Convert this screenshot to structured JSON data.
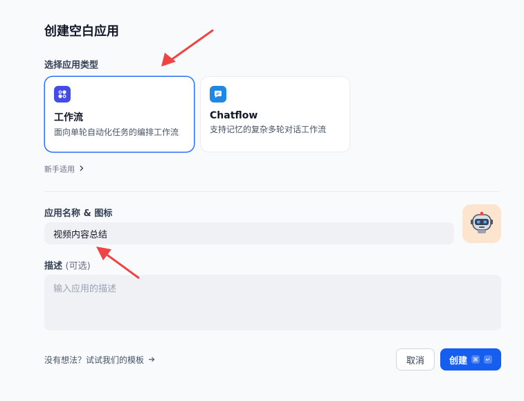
{
  "dialog": {
    "title": "创建空白应用",
    "type_label": "选择应用类型",
    "beginner_link": "新手适用",
    "name_icon_label": "应用名称 & 图标",
    "name_value": "视频内容总结",
    "description_label": "描述",
    "description_optional": "(可选)",
    "description_placeholder": "输入应用的描述",
    "template_link": "没有想法？试试我们的模板",
    "cancel_label": "取消",
    "create_label": "创建"
  },
  "app_types": [
    {
      "title": "工作流",
      "description": "面向单轮自动化任务的编排工作流",
      "selected": true,
      "icon": "workflow-icon",
      "icon_color": "#444ce7"
    },
    {
      "title": "Chatflow",
      "description": "支持记忆的复杂多轮对话工作流",
      "selected": false,
      "icon": "chatflow-icon",
      "icon_color": "#1e88e5"
    }
  ],
  "colors": {
    "accent": "#155eef",
    "selected_border": "#2970ff",
    "annotation_arrow": "#ef4444",
    "avatar_bg": "#fde4cf"
  },
  "icons": {
    "avatar": "robot-icon",
    "beginner_chevron": "chevron-right-icon",
    "template_arrow": "arrow-right-icon",
    "shortcut_cmd": "command-key-icon",
    "shortcut_enter": "enter-key-icon"
  }
}
